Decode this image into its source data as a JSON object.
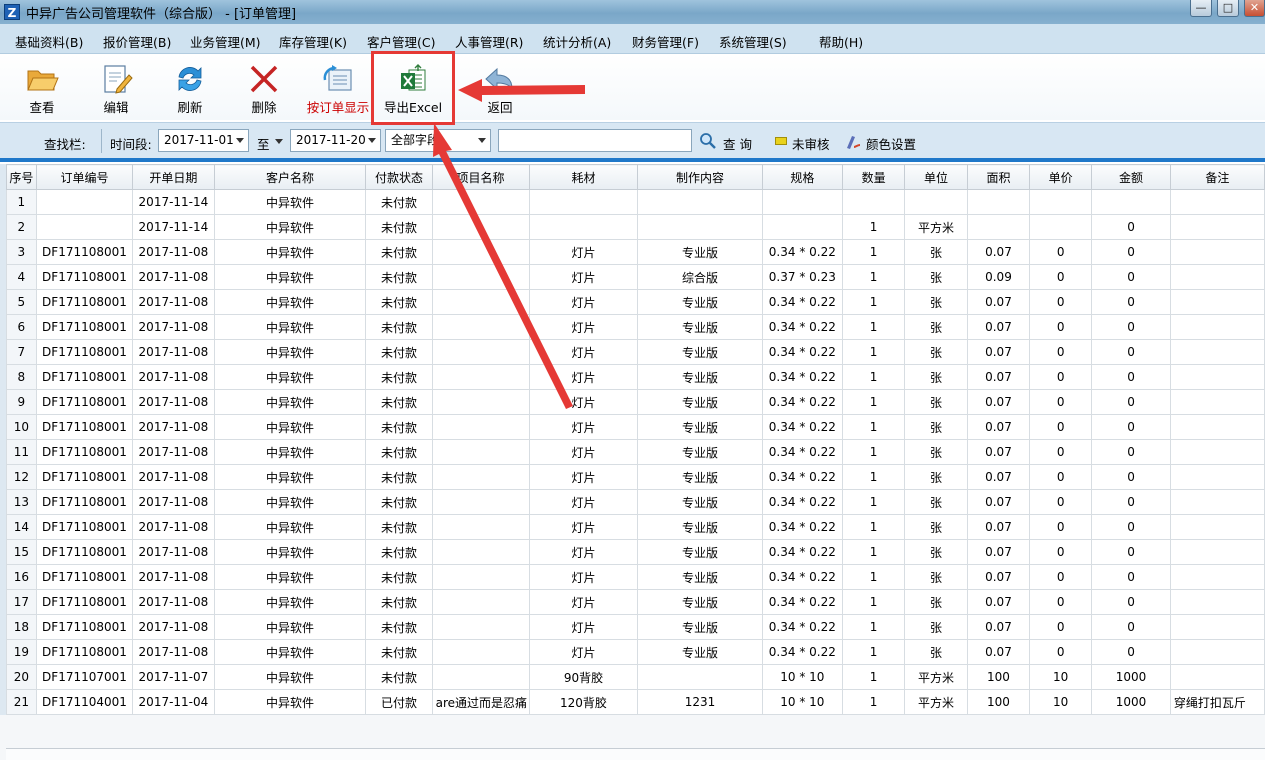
{
  "window": {
    "title": "中异广告公司管理软件（综合版） - [订单管理]",
    "icon_letter": "Z",
    "minimize": "—",
    "maximize": "□",
    "close": "✕"
  },
  "menu": [
    "基础资料(B)",
    "报价管理(B)",
    "业务管理(M)",
    "库存管理(K)",
    "客户管理(C)",
    "人事管理(R)",
    "统计分析(A)",
    "财务管理(F)",
    "系统管理(S)",
    "帮助(H)"
  ],
  "toolbar": {
    "view": "查看",
    "edit": "编辑",
    "refresh": "刷新",
    "delete": "删除",
    "by_order": "按订单显示",
    "export": "导出Excel",
    "back": "返回"
  },
  "search": {
    "label": "查找栏:",
    "period_label": "时间段:",
    "date_from": "2017-11-01",
    "to": "至",
    "date_to": "2017-11-20",
    "field": "全部字段",
    "keyword": "",
    "query": "查 询",
    "unreviewed": "未审核",
    "color_settings": "颜色设置"
  },
  "colors": {
    "accent_blue": "#1f78c9",
    "highlight_red": "#e53935"
  },
  "table": {
    "columns": [
      "序号",
      "订单编号",
      "开单日期",
      "客户名称",
      "付款状态",
      "项目名称",
      "耗材",
      "制作内容",
      "规格",
      "数量",
      "单位",
      "面积",
      "单价",
      "金额",
      "备注"
    ],
    "rows": [
      [
        "1",
        "",
        "2017-11-14",
        "中异软件",
        "未付款",
        "",
        "",
        "",
        "",
        "",
        "",
        "",
        "",
        "",
        ""
      ],
      [
        "2",
        "",
        "2017-11-14",
        "中异软件",
        "未付款",
        "",
        "",
        "",
        "",
        "1",
        "平方米",
        "",
        "",
        "0",
        ""
      ],
      [
        "3",
        "DF171108001",
        "2017-11-08",
        "中异软件",
        "未付款",
        "",
        "灯片",
        "专业版",
        "0.34 * 0.22",
        "1",
        "张",
        "0.07",
        "0",
        "0",
        ""
      ],
      [
        "4",
        "DF171108001",
        "2017-11-08",
        "中异软件",
        "未付款",
        "",
        "灯片",
        "综合版",
        "0.37 * 0.23",
        "1",
        "张",
        "0.09",
        "0",
        "0",
        ""
      ],
      [
        "5",
        "DF171108001",
        "2017-11-08",
        "中异软件",
        "未付款",
        "",
        "灯片",
        "专业版",
        "0.34 * 0.22",
        "1",
        "张",
        "0.07",
        "0",
        "0",
        ""
      ],
      [
        "6",
        "DF171108001",
        "2017-11-08",
        "中异软件",
        "未付款",
        "",
        "灯片",
        "专业版",
        "0.34 * 0.22",
        "1",
        "张",
        "0.07",
        "0",
        "0",
        ""
      ],
      [
        "7",
        "DF171108001",
        "2017-11-08",
        "中异软件",
        "未付款",
        "",
        "灯片",
        "专业版",
        "0.34 * 0.22",
        "1",
        "张",
        "0.07",
        "0",
        "0",
        ""
      ],
      [
        "8",
        "DF171108001",
        "2017-11-08",
        "中异软件",
        "未付款",
        "",
        "灯片",
        "专业版",
        "0.34 * 0.22",
        "1",
        "张",
        "0.07",
        "0",
        "0",
        ""
      ],
      [
        "9",
        "DF171108001",
        "2017-11-08",
        "中异软件",
        "未付款",
        "",
        "灯片",
        "专业版",
        "0.34 * 0.22",
        "1",
        "张",
        "0.07",
        "0",
        "0",
        ""
      ],
      [
        "10",
        "DF171108001",
        "2017-11-08",
        "中异软件",
        "未付款",
        "",
        "灯片",
        "专业版",
        "0.34 * 0.22",
        "1",
        "张",
        "0.07",
        "0",
        "0",
        ""
      ],
      [
        "11",
        "DF171108001",
        "2017-11-08",
        "中异软件",
        "未付款",
        "",
        "灯片",
        "专业版",
        "0.34 * 0.22",
        "1",
        "张",
        "0.07",
        "0",
        "0",
        ""
      ],
      [
        "12",
        "DF171108001",
        "2017-11-08",
        "中异软件",
        "未付款",
        "",
        "灯片",
        "专业版",
        "0.34 * 0.22",
        "1",
        "张",
        "0.07",
        "0",
        "0",
        ""
      ],
      [
        "13",
        "DF171108001",
        "2017-11-08",
        "中异软件",
        "未付款",
        "",
        "灯片",
        "专业版",
        "0.34 * 0.22",
        "1",
        "张",
        "0.07",
        "0",
        "0",
        ""
      ],
      [
        "14",
        "DF171108001",
        "2017-11-08",
        "中异软件",
        "未付款",
        "",
        "灯片",
        "专业版",
        "0.34 * 0.22",
        "1",
        "张",
        "0.07",
        "0",
        "0",
        ""
      ],
      [
        "15",
        "DF171108001",
        "2017-11-08",
        "中异软件",
        "未付款",
        "",
        "灯片",
        "专业版",
        "0.34 * 0.22",
        "1",
        "张",
        "0.07",
        "0",
        "0",
        ""
      ],
      [
        "16",
        "DF171108001",
        "2017-11-08",
        "中异软件",
        "未付款",
        "",
        "灯片",
        "专业版",
        "0.34 * 0.22",
        "1",
        "张",
        "0.07",
        "0",
        "0",
        ""
      ],
      [
        "17",
        "DF171108001",
        "2017-11-08",
        "中异软件",
        "未付款",
        "",
        "灯片",
        "专业版",
        "0.34 * 0.22",
        "1",
        "张",
        "0.07",
        "0",
        "0",
        ""
      ],
      [
        "18",
        "DF171108001",
        "2017-11-08",
        "中异软件",
        "未付款",
        "",
        "灯片",
        "专业版",
        "0.34 * 0.22",
        "1",
        "张",
        "0.07",
        "0",
        "0",
        ""
      ],
      [
        "19",
        "DF171108001",
        "2017-11-08",
        "中异软件",
        "未付款",
        "",
        "灯片",
        "专业版",
        "0.34 * 0.22",
        "1",
        "张",
        "0.07",
        "0",
        "0",
        ""
      ],
      [
        "20",
        "DF171107001",
        "2017-11-07",
        "中异软件",
        "未付款",
        "",
        "90背胶",
        "",
        "10 * 10",
        "1",
        "平方米",
        "100",
        "10",
        "1000",
        ""
      ],
      [
        "21",
        "DF171104001",
        "2017-11-04",
        "中异软件",
        "已付款",
        "are通过而是忍痛",
        "120背胶",
        "1231",
        "10 * 10",
        "1",
        "平方米",
        "100",
        "10",
        "1000",
        "穿绳打扣瓦斤"
      ]
    ]
  }
}
